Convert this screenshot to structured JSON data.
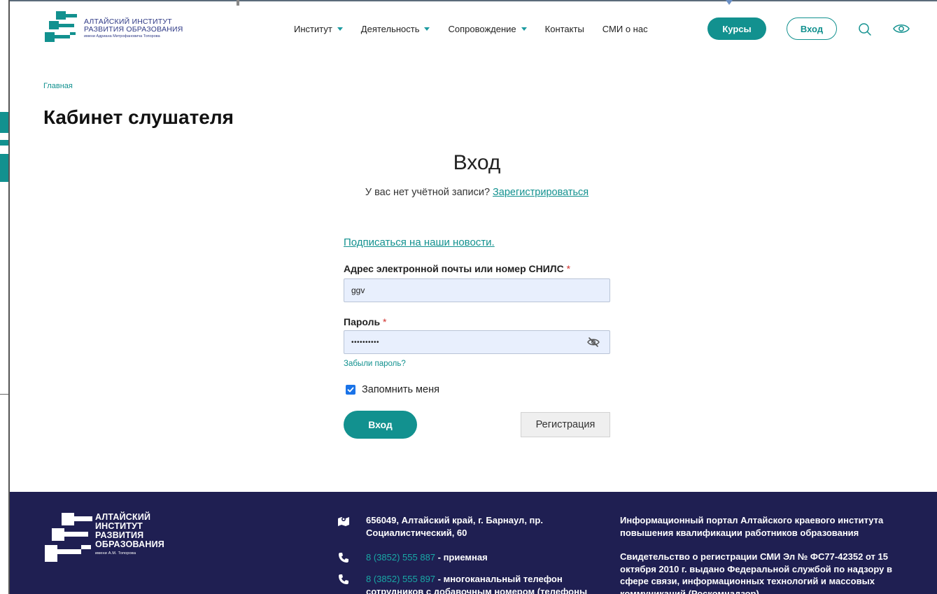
{
  "header": {
    "logo": {
      "line1": "АЛТАЙСКИЙ ИНСТИТУТ",
      "line2": "РАЗВИТИЯ ОБРАЗОВАНИЯ",
      "line3": "имени Адриана Митрофановича Топорова"
    },
    "nav": [
      {
        "label": "Институт",
        "has_dropdown": true
      },
      {
        "label": "Деятельность",
        "has_dropdown": true
      },
      {
        "label": "Сопровождение",
        "has_dropdown": true
      },
      {
        "label": "Контакты",
        "has_dropdown": false
      },
      {
        "label": "СМИ о нас",
        "has_dropdown": false
      }
    ],
    "courses_label": "Курсы",
    "login_label": "Вход",
    "search_icon": "search-icon",
    "accessibility_icon": "eye-icon"
  },
  "breadcrumb": "Главная",
  "page_title": "Кабинет слушателя",
  "login": {
    "title": "Вход",
    "no_account_text": "У вас нет учётной записи?",
    "register_link": "Зарегистрироваться",
    "subscribe_link": "Подписаться на наши новости.",
    "email_label": "Адрес электронной почты или номер СНИЛС",
    "email_value": "ggv",
    "password_label": "Пароль",
    "password_value": "••••••••••",
    "required_mark": "*",
    "forgot_link": "Забыли пароль?",
    "remember_label": "Запомнить меня",
    "remember_checked": true,
    "submit_label": "Вход",
    "register_button": "Регистрация"
  },
  "footer": {
    "logo": {
      "line1": "АЛТАЙСКИЙ",
      "line2": "ИНСТИТУТ",
      "line3": "РАЗВИТИЯ",
      "line4": "ОБРАЗОВАНИЯ",
      "line5": "имени А.М. Топорова"
    },
    "address": "656049, Алтайский край, г. Барнаул, пр. Социалистический, 60",
    "phone1_number": "8 (3852) 555 887",
    "phone1_desc": " - приемная",
    "phone2_number": "8 (3852) 555 897",
    "phone2_desc": " - многоканальный телефон сотрудников с добавочным номером (телефоны",
    "info": "Информационный портал Алтайского краевого института повышения квалификации работников образования",
    "certificate": "Свидетельство о регистрации СМИ Эл № ФС77-42352 от 15 октября 2010 г. выдано Федеральной службой по надзору в сфере связи, информационных технологий и массовых коммуникаций (Роскомнадзор)"
  },
  "colors": {
    "accent": "#12918f",
    "footer_bg": "#1f1f52",
    "input_bg": "#e8effd",
    "required": "#d0312d"
  }
}
